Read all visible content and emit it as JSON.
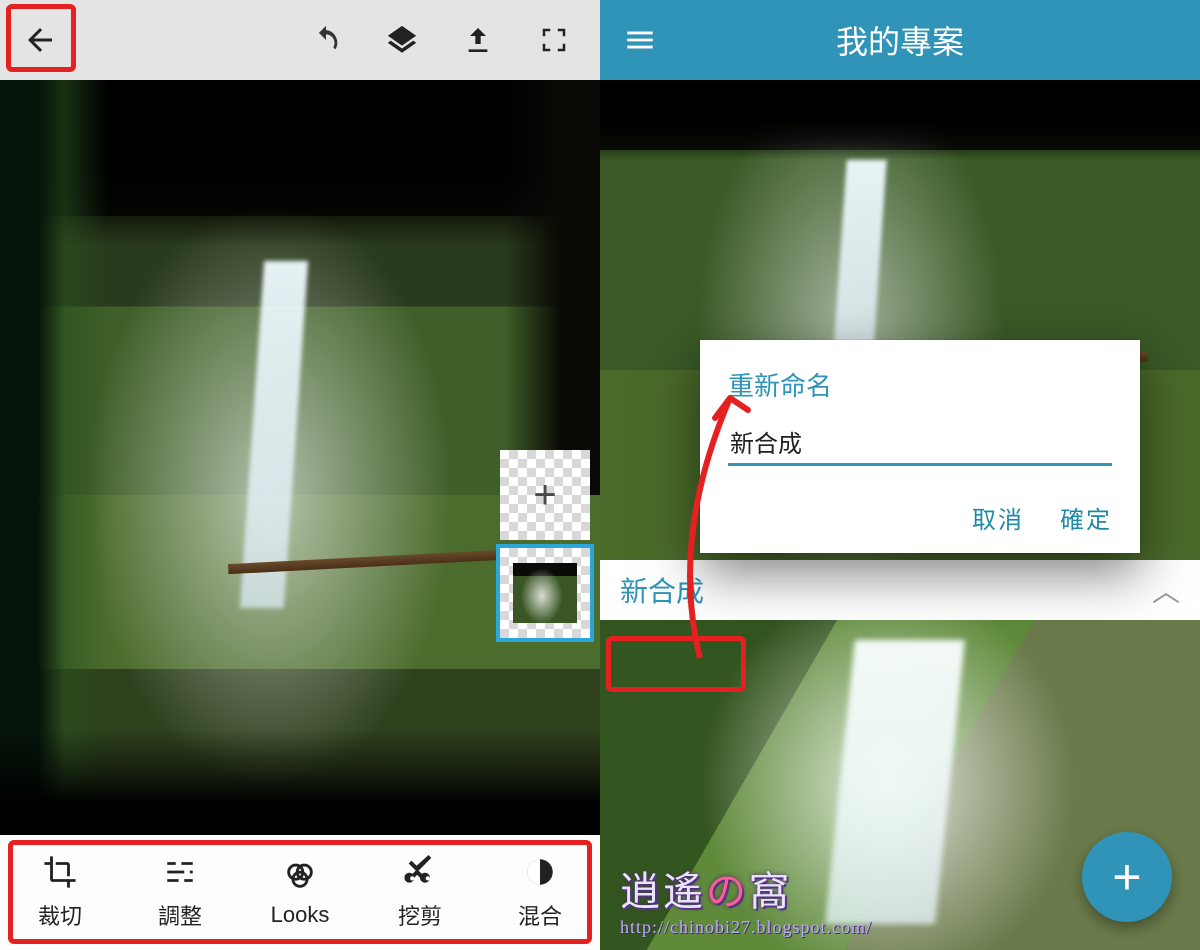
{
  "left": {
    "tools": [
      {
        "id": "crop",
        "label": "裁切"
      },
      {
        "id": "adjust",
        "label": "調整"
      },
      {
        "id": "looks",
        "label": "Looks"
      },
      {
        "id": "cutout",
        "label": "挖剪"
      },
      {
        "id": "blend",
        "label": "混合"
      }
    ]
  },
  "right": {
    "title": "我的專案",
    "project_name": "新合成",
    "dialog": {
      "title": "重新命名",
      "value": "新合成",
      "cancel": "取消",
      "ok": "確定"
    },
    "watermark": {
      "text_a": "逍",
      "text_b": "遙",
      "text_c": "の",
      "text_d": "窩",
      "url": "http://chinobi27.blogspot.com/"
    },
    "fab_glyph": "+"
  },
  "colors": {
    "accent": "#2f94b7",
    "highlight": "#e52020"
  }
}
